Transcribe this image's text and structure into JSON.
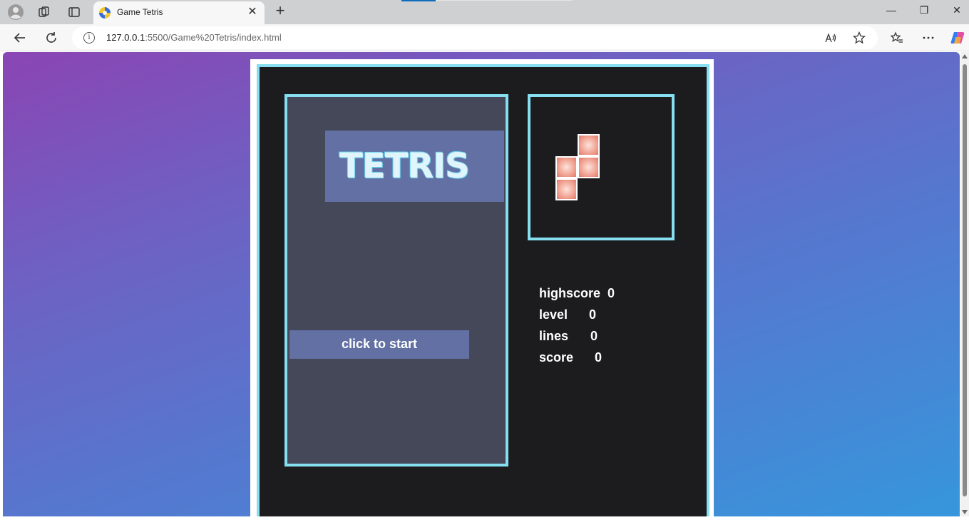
{
  "browser": {
    "tab_title": "Game Tetris",
    "tab_close": "✕",
    "new_tab": "+",
    "url_host": "127.0.0.1",
    "url_rest": ":5500/Game%20Tetris/index.html",
    "window_controls": {
      "minimize": "—",
      "restore": "❐",
      "close": "✕"
    },
    "info_icon": "i",
    "icons": [
      "profile-icon",
      "workspaces-icon",
      "tab-actions-icon",
      "back-icon",
      "refresh-icon",
      "read-aloud-icon",
      "favorite-star-icon",
      "favorites-icon",
      "more-icon",
      "copilot-icon"
    ]
  },
  "game": {
    "title": "TETRIS",
    "start_label": "click to start",
    "stats": [
      {
        "label": "highscore",
        "value": "0"
      },
      {
        "label": "level",
        "value": "0"
      },
      {
        "label": "lines",
        "value": "0"
      },
      {
        "label": "score",
        "value": "0"
      }
    ],
    "next_piece": "S",
    "colors": {
      "border": "#86dff0",
      "board_bg": "#454859",
      "panel_bg": "#1c1c1e",
      "button_bg": "#6270a4",
      "block": "#f2a898"
    }
  }
}
